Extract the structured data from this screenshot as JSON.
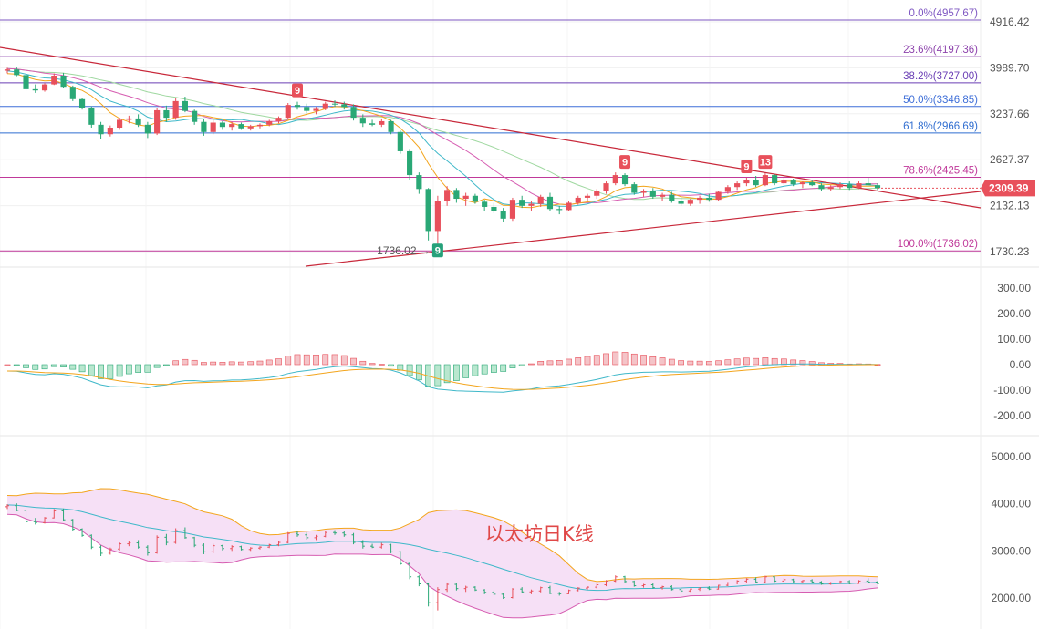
{
  "chart_data": {
    "type": "candlestick",
    "title": "以太坊日K线",
    "current_price": "2309.39",
    "low_marker": "1736.02",
    "price_axis": {
      "range": [
        1650,
        5000
      ],
      "ticks": [
        "4916.42",
        "3989.70",
        "3237.66",
        "2627.37",
        "2132.13",
        "1730.23"
      ]
    },
    "fibonacci": [
      {
        "label": "0.0%(4957.67)",
        "price": 4957.67,
        "color": "#7e57c2"
      },
      {
        "label": "23.6%(4197.36)",
        "price": 4197.36,
        "color": "#8e44ad"
      },
      {
        "label": "38.2%(3727.00)",
        "price": 3727.0,
        "color": "#6a3fb5"
      },
      {
        "label": "50.0%(3346.85)",
        "price": 3346.85,
        "color": "#3f6fd8"
      },
      {
        "label": "61.8%(2966.69)",
        "price": 2966.69,
        "color": "#2f6dd0"
      },
      {
        "label": "78.6%(2425.45)",
        "price": 2425.45,
        "color": "#c0399a"
      },
      {
        "label": "100.0%(1736.02)",
        "price": 1736.02,
        "color": "#c0399a"
      }
    ],
    "macd_axis": {
      "ticks": [
        "300.00",
        "200.00",
        "100.00",
        "0.00",
        "-100.00",
        "-200.00"
      ],
      "range": [
        -280,
        330
      ]
    },
    "boll_axis": {
      "ticks": [
        "5000.00",
        "4000.00",
        "3000.00",
        "2000.00"
      ],
      "range": [
        1550,
        5300
      ]
    },
    "signals": [
      {
        "label": "9",
        "index": 31,
        "where": "top",
        "color": "#e8505b"
      },
      {
        "label": "9",
        "index": 46,
        "where": "bottom",
        "color": "#26a17a"
      },
      {
        "label": "9",
        "index": 66,
        "where": "top",
        "color": "#e8505b"
      },
      {
        "label": "9",
        "index": 79,
        "where": "top",
        "color": "#e8505b"
      },
      {
        "label": "13",
        "index": 81,
        "where": "top",
        "color": "#e8505b"
      }
    ],
    "candles": [
      [
        3938,
        3990,
        3890,
        3960
      ],
      [
        3960,
        4010,
        3840,
        3860
      ],
      [
        3860,
        3880,
        3590,
        3620
      ],
      [
        3620,
        3700,
        3560,
        3600
      ],
      [
        3600,
        3720,
        3580,
        3700
      ],
      [
        3700,
        3890,
        3690,
        3850
      ],
      [
        3850,
        3900,
        3640,
        3660
      ],
      [
        3660,
        3680,
        3430,
        3460
      ],
      [
        3460,
        3480,
        3300,
        3330
      ],
      [
        3330,
        3350,
        3040,
        3080
      ],
      [
        3080,
        3120,
        2890,
        2950
      ],
      [
        2950,
        3070,
        2920,
        3040
      ],
      [
        3040,
        3180,
        3010,
        3150
      ],
      [
        3150,
        3210,
        3100,
        3170
      ],
      [
        3170,
        3230,
        3050,
        3080
      ],
      [
        3080,
        3120,
        2900,
        2960
      ],
      [
        2960,
        3330,
        2940,
        3290
      ],
      [
        3290,
        3360,
        3120,
        3180
      ],
      [
        3180,
        3480,
        3150,
        3430
      ],
      [
        3430,
        3500,
        3260,
        3280
      ],
      [
        3280,
        3300,
        3080,
        3120
      ],
      [
        3120,
        3160,
        2930,
        2980
      ],
      [
        2980,
        3150,
        2950,
        3110
      ],
      [
        3110,
        3130,
        3010,
        3050
      ],
      [
        3050,
        3120,
        3000,
        3090
      ],
      [
        3090,
        3110,
        3010,
        3030
      ],
      [
        3030,
        3080,
        3000,
        3060
      ],
      [
        3060,
        3100,
        3030,
        3080
      ],
      [
        3080,
        3150,
        3060,
        3130
      ],
      [
        3130,
        3200,
        3100,
        3180
      ],
      [
        3180,
        3400,
        3160,
        3370
      ],
      [
        3370,
        3420,
        3300,
        3340
      ],
      [
        3340,
        3390,
        3240,
        3280
      ],
      [
        3280,
        3340,
        3230,
        3310
      ],
      [
        3310,
        3420,
        3290,
        3390
      ],
      [
        3390,
        3440,
        3340,
        3380
      ],
      [
        3380,
        3420,
        3300,
        3340
      ],
      [
        3340,
        3380,
        3140,
        3180
      ],
      [
        3180,
        3230,
        3050,
        3100
      ],
      [
        3100,
        3150,
        3060,
        3080
      ],
      [
        3080,
        3170,
        3050,
        3130
      ],
      [
        3130,
        3150,
        2950,
        2980
      ],
      [
        2980,
        3000,
        2700,
        2730
      ],
      [
        2730,
        2760,
        2400,
        2450
      ],
      [
        2450,
        2480,
        2250,
        2300
      ],
      [
        2300,
        2310,
        1820,
        1900
      ],
      [
        1900,
        2230,
        1736,
        2180
      ],
      [
        2180,
        2330,
        2130,
        2290
      ],
      [
        2290,
        2310,
        2160,
        2200
      ],
      [
        2200,
        2260,
        2130,
        2230
      ],
      [
        2230,
        2250,
        2150,
        2170
      ],
      [
        2170,
        2190,
        2080,
        2120
      ],
      [
        2120,
        2160,
        2060,
        2080
      ],
      [
        2080,
        2110,
        1980,
        2010
      ],
      [
        2010,
        2210,
        1990,
        2190
      ],
      [
        2190,
        2230,
        2110,
        2130
      ],
      [
        2130,
        2180,
        2080,
        2150
      ],
      [
        2150,
        2240,
        2120,
        2220
      ],
      [
        2220,
        2260,
        2080,
        2100
      ],
      [
        2100,
        2130,
        2050,
        2090
      ],
      [
        2090,
        2180,
        2080,
        2160
      ],
      [
        2160,
        2230,
        2140,
        2210
      ],
      [
        2210,
        2250,
        2180,
        2230
      ],
      [
        2230,
        2300,
        2200,
        2280
      ],
      [
        2280,
        2380,
        2250,
        2360
      ],
      [
        2360,
        2480,
        2340,
        2450
      ],
      [
        2450,
        2470,
        2330,
        2350
      ],
      [
        2350,
        2370,
        2240,
        2260
      ],
      [
        2260,
        2300,
        2220,
        2280
      ],
      [
        2280,
        2310,
        2200,
        2220
      ],
      [
        2220,
        2260,
        2180,
        2240
      ],
      [
        2240,
        2270,
        2160,
        2180
      ],
      [
        2180,
        2210,
        2130,
        2150
      ],
      [
        2150,
        2200,
        2130,
        2190
      ],
      [
        2190,
        2230,
        2150,
        2210
      ],
      [
        2210,
        2250,
        2170,
        2190
      ],
      [
        2190,
        2280,
        2180,
        2270
      ],
      [
        2270,
        2340,
        2250,
        2320
      ],
      [
        2320,
        2380,
        2290,
        2360
      ],
      [
        2360,
        2420,
        2330,
        2400
      ],
      [
        2400,
        2440,
        2320,
        2340
      ],
      [
        2340,
        2470,
        2330,
        2450
      ],
      [
        2450,
        2460,
        2340,
        2360
      ],
      [
        2360,
        2420,
        2340,
        2390
      ],
      [
        2390,
        2410,
        2330,
        2350
      ],
      [
        2350,
        2380,
        2310,
        2370
      ],
      [
        2370,
        2400,
        2330,
        2340
      ],
      [
        2340,
        2360,
        2280,
        2300
      ],
      [
        2300,
        2340,
        2280,
        2320
      ],
      [
        2320,
        2370,
        2300,
        2350
      ],
      [
        2350,
        2380,
        2290,
        2310
      ],
      [
        2310,
        2380,
        2300,
        2360
      ],
      [
        2360,
        2420,
        2340,
        2340
      ],
      [
        2340,
        2360,
        2290,
        2309.39
      ]
    ]
  }
}
